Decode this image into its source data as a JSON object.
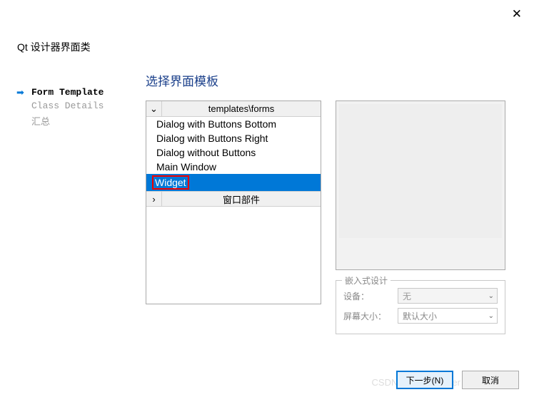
{
  "dialog": {
    "title": "Qt 设计器界面类"
  },
  "steps": [
    {
      "label": "Form Template",
      "active": true
    },
    {
      "label": "Class Details",
      "active": false
    },
    {
      "label": "汇总",
      "active": false
    }
  ],
  "section_title": "选择界面模板",
  "tree": {
    "root_label": "templates\\forms",
    "toggle_glyph": "⌄",
    "items": [
      "Dialog with Buttons Bottom",
      "Dialog with Buttons Right",
      "Dialog without Buttons",
      "Main Window",
      "Widget"
    ],
    "selected_index": 4,
    "sub_toggle_glyph": "›",
    "sub_label": "窗口部件"
  },
  "embedded": {
    "legend": "嵌入式设计",
    "device_label": "设备：",
    "device_value": "无",
    "size_label": "屏幕大小：",
    "size_value": "默认大小"
  },
  "buttons": {
    "next": "下一步(N)",
    "cancel": "取消"
  },
  "close_glyph": "✕",
  "combo_arrow": "⌄",
  "watermark": "CSDN @StudyWinter"
}
